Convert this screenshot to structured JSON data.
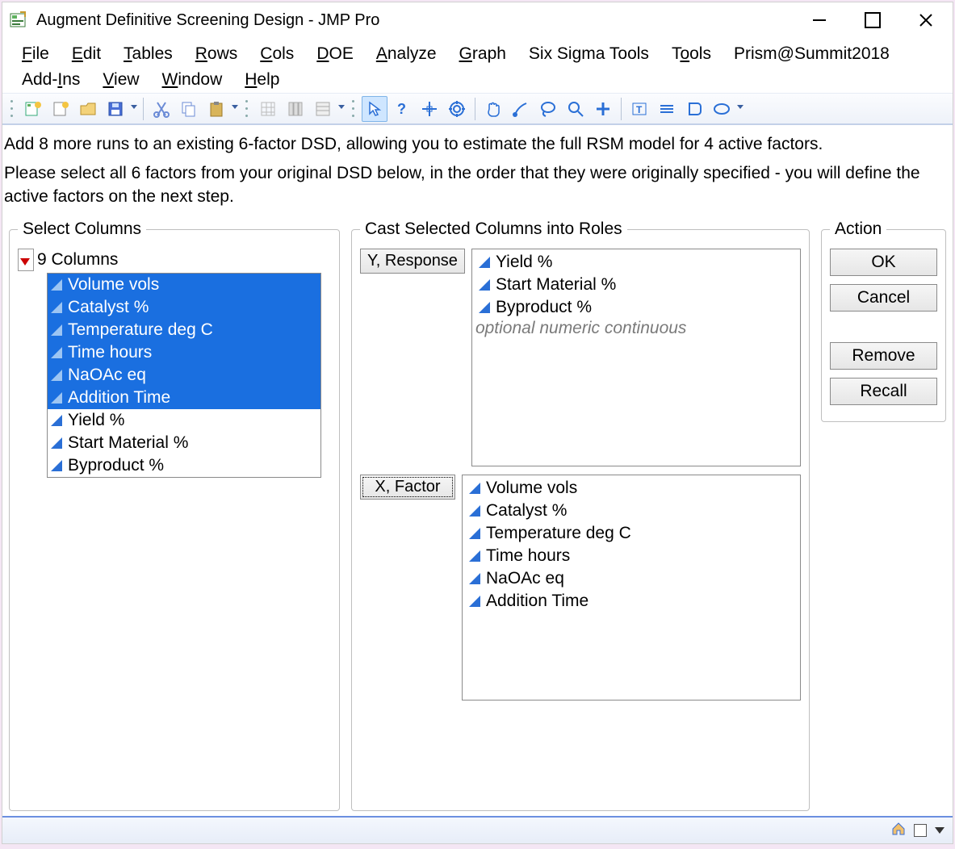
{
  "window": {
    "title": "Augment Definitive Screening Design - JMP Pro"
  },
  "menu": {
    "file": "File",
    "edit": "Edit",
    "tables": "Tables",
    "rows": "Rows",
    "cols": "Cols",
    "doe": "DOE",
    "analyze": "Analyze",
    "graph": "Graph",
    "six_sigma": "Six Sigma Tools",
    "tools": "Tools",
    "prism": "Prism@Summit2018",
    "addins": "Add-Ins",
    "view": "View",
    "window_m": "Window",
    "help": "Help"
  },
  "instructions": {
    "line1": "Add 8 more runs to an existing 6-factor DSD, allowing you to estimate the full RSM model for 4 active factors.",
    "line2": "Please select all 6 factors from your original DSD below, in the order that they were originally specified - you will define the active factors on the next step."
  },
  "select_panel": {
    "legend": "Select Columns",
    "header": "9 Columns",
    "columns": [
      {
        "label": "Volume vols",
        "selected": true
      },
      {
        "label": "Catalyst %",
        "selected": true
      },
      {
        "label": "Temperature deg C",
        "selected": true
      },
      {
        "label": "Time hours",
        "selected": true
      },
      {
        "label": "NaOAc eq",
        "selected": true
      },
      {
        "label": "Addition Time",
        "selected": true
      },
      {
        "label": "Yield %",
        "selected": false
      },
      {
        "label": "Start Material %",
        "selected": false
      },
      {
        "label": "Byproduct %",
        "selected": false
      }
    ]
  },
  "cast_panel": {
    "legend": "Cast Selected Columns into Roles",
    "y_label": "Y, Response",
    "y_items": [
      "Yield %",
      "Start Material %",
      "Byproduct %"
    ],
    "y_hint": "optional numeric continuous",
    "x_label": "X, Factor",
    "x_items": [
      "Volume vols",
      "Catalyst %",
      "Temperature deg C",
      "Time hours",
      "NaOAc eq",
      "Addition Time"
    ]
  },
  "action_panel": {
    "legend": "Action",
    "ok": "OK",
    "cancel": "Cancel",
    "remove": "Remove",
    "recall": "Recall"
  },
  "toolbar_icons": [
    "new-table-icon",
    "new-script-icon",
    "open-icon",
    "save-icon",
    "cut-icon",
    "copy-icon",
    "paste-icon",
    "grid-icon",
    "columns-icon",
    "rows-icon",
    "arrow-icon",
    "help-icon",
    "crosshair-icon",
    "target-icon",
    "hand-icon",
    "brush-icon",
    "lasso-icon",
    "zoom-icon",
    "add-icon",
    "text-annot-icon",
    "line-annot-icon",
    "shape-annot-icon",
    "oval-annot-icon"
  ]
}
